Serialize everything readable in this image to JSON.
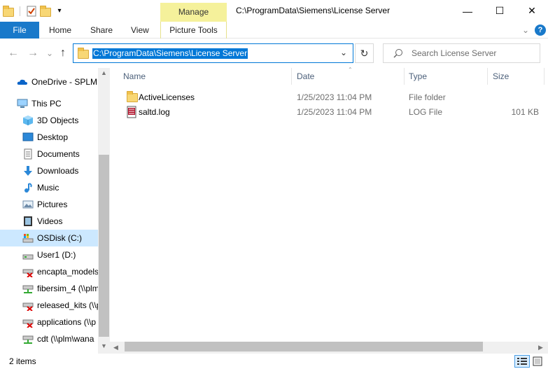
{
  "title_bar": {
    "manage_tab": "Manage",
    "path": "C:\\ProgramData\\Siemens\\License Server",
    "minimize": "—",
    "maximize": "☐",
    "close": "✕"
  },
  "ribbon": {
    "tabs": [
      "File",
      "Home",
      "Share",
      "View"
    ],
    "picture_tools": "Picture Tools",
    "expand": "⌄",
    "help": "?"
  },
  "nav": {
    "back": "←",
    "forward": "→",
    "recent": "⌄",
    "up": "↑",
    "address": "C:\\ProgramData\\Siemens\\License Server",
    "dropdown": "⌄",
    "refresh": "↻",
    "search_placeholder": "Search License Server"
  },
  "sidebar": {
    "items": [
      {
        "label": "OneDrive - SPLM",
        "icon": "cloud-icon"
      },
      {
        "label": "This PC",
        "icon": "computer-icon"
      },
      {
        "label": "3D Objects",
        "icon": "cube-icon"
      },
      {
        "label": "Desktop",
        "icon": "desktop-icon"
      },
      {
        "label": "Documents",
        "icon": "document-icon"
      },
      {
        "label": "Downloads",
        "icon": "download-icon"
      },
      {
        "label": "Music",
        "icon": "music-icon"
      },
      {
        "label": "Pictures",
        "icon": "picture-icon"
      },
      {
        "label": "Videos",
        "icon": "video-icon"
      },
      {
        "label": "OSDisk (C:)",
        "icon": "drive-icon"
      },
      {
        "label": "User1 (D:)",
        "icon": "drive-icon"
      },
      {
        "label": "encapta_models",
        "icon": "network-drive-disconnected-icon"
      },
      {
        "label": "fibersim_4 (\\\\plm",
        "icon": "network-drive-icon"
      },
      {
        "label": "released_kits (\\\\p",
        "icon": "network-drive-disconnected-icon"
      },
      {
        "label": "applications (\\\\p",
        "icon": "network-drive-disconnected-icon"
      },
      {
        "label": "cdt (\\\\plm\\wana",
        "icon": "network-drive-icon"
      }
    ]
  },
  "columns": {
    "name": "Name",
    "date": "Date",
    "type": "Type",
    "size": "Size"
  },
  "files": [
    {
      "name": "ActiveLicenses",
      "date": "1/25/2023 11:04 PM",
      "type": "File folder",
      "size": ""
    },
    {
      "name": "saltd.log",
      "date": "1/25/2023 11:04 PM",
      "type": "LOG File",
      "size": "101 KB"
    }
  ],
  "status": {
    "items": "2 items"
  },
  "colors": {
    "accent": "#0078d7",
    "file_tab": "#1979ca",
    "manage_tab": "#f5f19b",
    "selection": "#cce8ff"
  }
}
